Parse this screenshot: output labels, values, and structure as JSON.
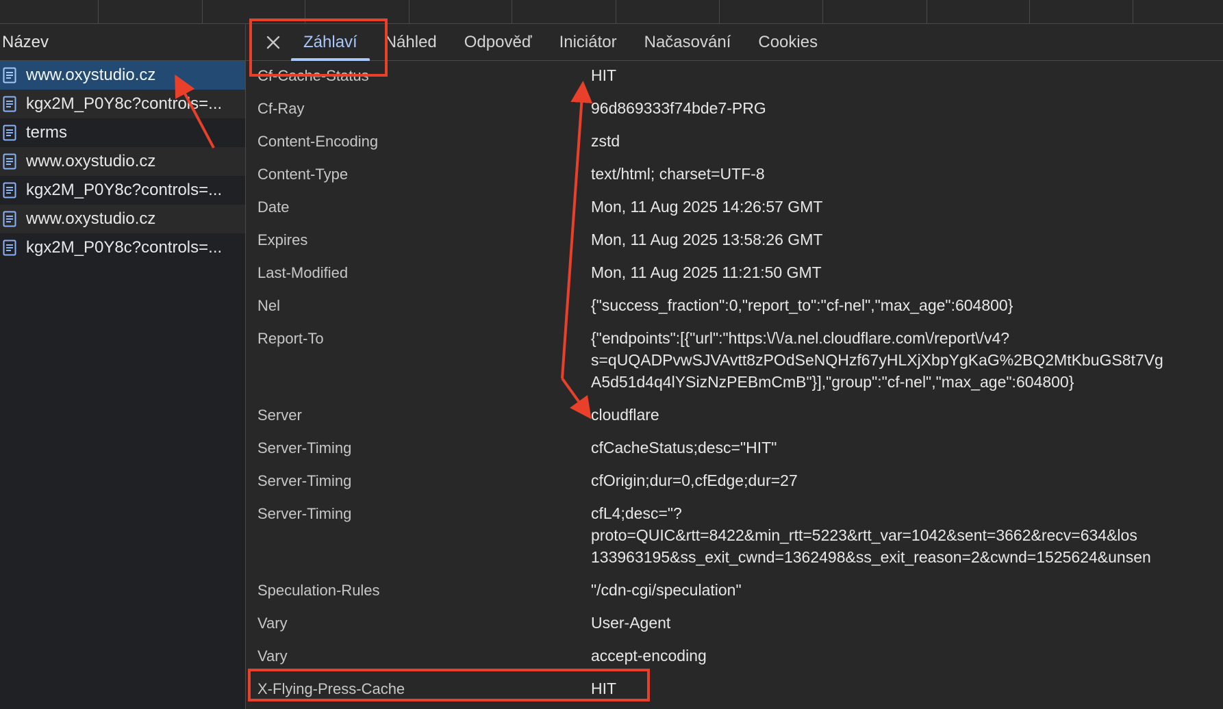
{
  "list": {
    "header": "Název",
    "items": [
      {
        "label": "www.oxystudio.cz",
        "selected": true
      },
      {
        "label": "kgx2M_P0Y8c?controls=..."
      },
      {
        "label": "terms"
      },
      {
        "label": "www.oxystudio.cz"
      },
      {
        "label": "kgx2M_P0Y8c?controls=..."
      },
      {
        "label": "www.oxystudio.cz"
      },
      {
        "label": "kgx2M_P0Y8c?controls=..."
      }
    ]
  },
  "tabs": {
    "close_icon": "close-icon",
    "items": [
      {
        "label": "Záhlaví",
        "active": true
      },
      {
        "label": "Náhled"
      },
      {
        "label": "Odpověď"
      },
      {
        "label": "Iniciátor"
      },
      {
        "label": "Načasování"
      },
      {
        "label": "Cookies"
      }
    ]
  },
  "headers": [
    {
      "name": "Cf-Cache-Status",
      "value": "HIT"
    },
    {
      "name": "Cf-Ray",
      "value": "96d869333f74bde7-PRG"
    },
    {
      "name": "Content-Encoding",
      "value": "zstd"
    },
    {
      "name": "Content-Type",
      "value": "text/html; charset=UTF-8"
    },
    {
      "name": "Date",
      "value": "Mon, 11 Aug 2025 14:26:57 GMT"
    },
    {
      "name": "Expires",
      "value": "Mon, 11 Aug 2025 13:58:26 GMT"
    },
    {
      "name": "Last-Modified",
      "value": "Mon, 11 Aug 2025 11:21:50 GMT"
    },
    {
      "name": "Nel",
      "value": "{\"success_fraction\":0,\"report_to\":\"cf-nel\",\"max_age\":604800}"
    },
    {
      "name": "Report-To",
      "value": "{\"endpoints\":[{\"url\":\"https:\\/\\/a.nel.cloudflare.com\\/report\\/v4?\ns=qUQADPvwSJVAvtt8zPOdSeNQHzf67yHLXjXbpYgKaG%2BQ2MtKbuGS8t7Vg\nA5d51d4q4lYSizNzPEBmCmB\"}],\"group\":\"cf-nel\",\"max_age\":604800}"
    },
    {
      "name": "Server",
      "value": "cloudflare"
    },
    {
      "name": "Server-Timing",
      "value": "cfCacheStatus;desc=\"HIT\""
    },
    {
      "name": "Server-Timing",
      "value": "cfOrigin;dur=0,cfEdge;dur=27"
    },
    {
      "name": "Server-Timing",
      "value": "cfL4;desc=\"?\nproto=QUIC&rtt=8422&min_rtt=5223&rtt_var=1042&sent=3662&recv=634&los\n133963195&ss_exit_cwnd=1362498&ss_exit_reason=2&cwnd=1525624&unsen"
    },
    {
      "name": "Speculation-Rules",
      "value": "\"/cdn-cgi/speculation\""
    },
    {
      "name": "Vary",
      "value": "User-Agent"
    },
    {
      "name": "Vary",
      "value": "accept-encoding"
    },
    {
      "name": "X-Flying-Press-Cache",
      "value": "HIT"
    }
  ],
  "colors": {
    "annotation": "#e8402a",
    "selected_row": "#224a73",
    "active_tab": "#a8c7fa",
    "background": "#282828"
  }
}
